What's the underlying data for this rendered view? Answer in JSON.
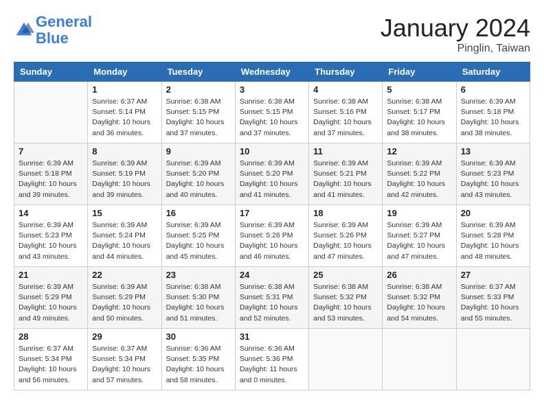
{
  "header": {
    "logo_line1": "General",
    "logo_line2": "Blue",
    "month_title": "January 2024",
    "location": "Pinglin, Taiwan"
  },
  "weekdays": [
    "Sunday",
    "Monday",
    "Tuesday",
    "Wednesday",
    "Thursday",
    "Friday",
    "Saturday"
  ],
  "weeks": [
    [
      {
        "day": "",
        "info": ""
      },
      {
        "day": "1",
        "info": "Sunrise: 6:37 AM\nSunset: 5:14 PM\nDaylight: 10 hours\nand 36 minutes."
      },
      {
        "day": "2",
        "info": "Sunrise: 6:38 AM\nSunset: 5:15 PM\nDaylight: 10 hours\nand 37 minutes."
      },
      {
        "day": "3",
        "info": "Sunrise: 6:38 AM\nSunset: 5:15 PM\nDaylight: 10 hours\nand 37 minutes."
      },
      {
        "day": "4",
        "info": "Sunrise: 6:38 AM\nSunset: 5:16 PM\nDaylight: 10 hours\nand 37 minutes."
      },
      {
        "day": "5",
        "info": "Sunrise: 6:38 AM\nSunset: 5:17 PM\nDaylight: 10 hours\nand 38 minutes."
      },
      {
        "day": "6",
        "info": "Sunrise: 6:39 AM\nSunset: 5:18 PM\nDaylight: 10 hours\nand 38 minutes."
      }
    ],
    [
      {
        "day": "7",
        "info": "Sunrise: 6:39 AM\nSunset: 5:18 PM\nDaylight: 10 hours\nand 39 minutes."
      },
      {
        "day": "8",
        "info": "Sunrise: 6:39 AM\nSunset: 5:19 PM\nDaylight: 10 hours\nand 39 minutes."
      },
      {
        "day": "9",
        "info": "Sunrise: 6:39 AM\nSunset: 5:20 PM\nDaylight: 10 hours\nand 40 minutes."
      },
      {
        "day": "10",
        "info": "Sunrise: 6:39 AM\nSunset: 5:20 PM\nDaylight: 10 hours\nand 41 minutes."
      },
      {
        "day": "11",
        "info": "Sunrise: 6:39 AM\nSunset: 5:21 PM\nDaylight: 10 hours\nand 41 minutes."
      },
      {
        "day": "12",
        "info": "Sunrise: 6:39 AM\nSunset: 5:22 PM\nDaylight: 10 hours\nand 42 minutes."
      },
      {
        "day": "13",
        "info": "Sunrise: 6:39 AM\nSunset: 5:23 PM\nDaylight: 10 hours\nand 43 minutes."
      }
    ],
    [
      {
        "day": "14",
        "info": "Sunrise: 6:39 AM\nSunset: 5:23 PM\nDaylight: 10 hours\nand 43 minutes."
      },
      {
        "day": "15",
        "info": "Sunrise: 6:39 AM\nSunset: 5:24 PM\nDaylight: 10 hours\nand 44 minutes."
      },
      {
        "day": "16",
        "info": "Sunrise: 6:39 AM\nSunset: 5:25 PM\nDaylight: 10 hours\nand 45 minutes."
      },
      {
        "day": "17",
        "info": "Sunrise: 6:39 AM\nSunset: 5:26 PM\nDaylight: 10 hours\nand 46 minutes."
      },
      {
        "day": "18",
        "info": "Sunrise: 6:39 AM\nSunset: 5:26 PM\nDaylight: 10 hours\nand 47 minutes."
      },
      {
        "day": "19",
        "info": "Sunrise: 6:39 AM\nSunset: 5:27 PM\nDaylight: 10 hours\nand 47 minutes."
      },
      {
        "day": "20",
        "info": "Sunrise: 6:39 AM\nSunset: 5:28 PM\nDaylight: 10 hours\nand 48 minutes."
      }
    ],
    [
      {
        "day": "21",
        "info": "Sunrise: 6:39 AM\nSunset: 5:29 PM\nDaylight: 10 hours\nand 49 minutes."
      },
      {
        "day": "22",
        "info": "Sunrise: 6:39 AM\nSunset: 5:29 PM\nDaylight: 10 hours\nand 50 minutes."
      },
      {
        "day": "23",
        "info": "Sunrise: 6:38 AM\nSunset: 5:30 PM\nDaylight: 10 hours\nand 51 minutes."
      },
      {
        "day": "24",
        "info": "Sunrise: 6:38 AM\nSunset: 5:31 PM\nDaylight: 10 hours\nand 52 minutes."
      },
      {
        "day": "25",
        "info": "Sunrise: 6:38 AM\nSunset: 5:32 PM\nDaylight: 10 hours\nand 53 minutes."
      },
      {
        "day": "26",
        "info": "Sunrise: 6:38 AM\nSunset: 5:32 PM\nDaylight: 10 hours\nand 54 minutes."
      },
      {
        "day": "27",
        "info": "Sunrise: 6:37 AM\nSunset: 5:33 PM\nDaylight: 10 hours\nand 55 minutes."
      }
    ],
    [
      {
        "day": "28",
        "info": "Sunrise: 6:37 AM\nSunset: 5:34 PM\nDaylight: 10 hours\nand 56 minutes."
      },
      {
        "day": "29",
        "info": "Sunrise: 6:37 AM\nSunset: 5:34 PM\nDaylight: 10 hours\nand 57 minutes."
      },
      {
        "day": "30",
        "info": "Sunrise: 6:36 AM\nSunset: 5:35 PM\nDaylight: 10 hours\nand 58 minutes."
      },
      {
        "day": "31",
        "info": "Sunrise: 6:36 AM\nSunset: 5:36 PM\nDaylight: 11 hours\nand 0 minutes."
      },
      {
        "day": "",
        "info": ""
      },
      {
        "day": "",
        "info": ""
      },
      {
        "day": "",
        "info": ""
      }
    ]
  ]
}
